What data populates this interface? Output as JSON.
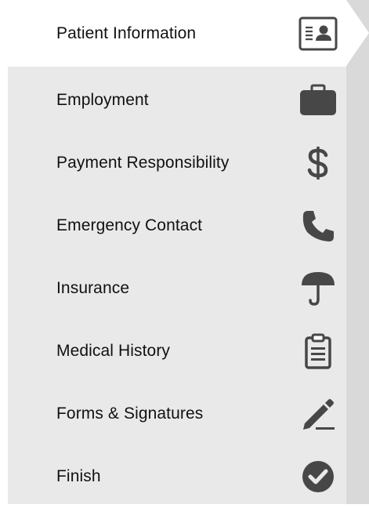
{
  "nav": {
    "items": [
      {
        "label": "Patient Information",
        "icon": "id-card-icon",
        "active": true
      },
      {
        "label": "Employment",
        "icon": "briefcase-icon",
        "active": false
      },
      {
        "label": "Payment Responsibility",
        "icon": "dollar-icon",
        "active": false
      },
      {
        "label": "Emergency Contact",
        "icon": "phone-icon",
        "active": false
      },
      {
        "label": "Insurance",
        "icon": "umbrella-icon",
        "active": false
      },
      {
        "label": "Medical History",
        "icon": "clipboard-icon",
        "active": false
      },
      {
        "label": "Forms & Signatures",
        "icon": "pencil-icon",
        "active": false
      },
      {
        "label": "Finish",
        "icon": "check-circle-icon",
        "active": false
      }
    ]
  },
  "colors": {
    "icon": "#474747",
    "panel_bg": "#e9e9e9",
    "active_bg": "#ffffff",
    "text": "#111111"
  }
}
